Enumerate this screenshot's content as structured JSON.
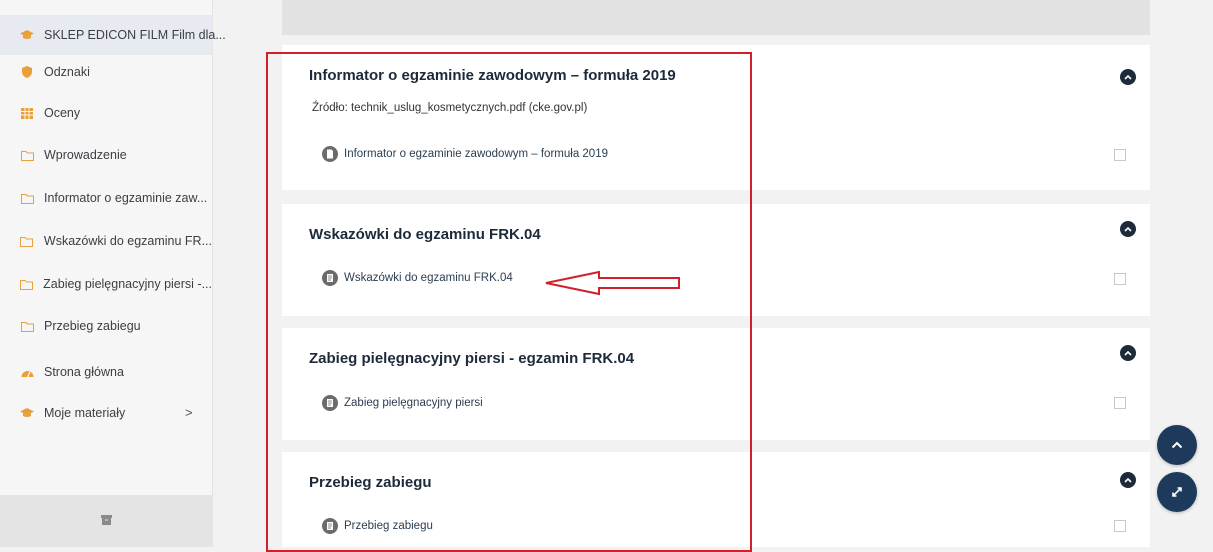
{
  "sidebar": {
    "items": [
      {
        "label": "SKLEP EDICON FILM Film dla...",
        "icon": "graduation-cap-icon",
        "active": true
      },
      {
        "label": "Odznaki",
        "icon": "shield-icon"
      },
      {
        "label": "Oceny",
        "icon": "grid-table-icon"
      },
      {
        "label": "Wprowadzenie",
        "icon": "folder-icon"
      },
      {
        "label": "Informator o egzaminie zaw...",
        "icon": "folder-icon"
      },
      {
        "label": "Wskazówki do egzaminu FR...",
        "icon": "folder-icon"
      },
      {
        "label": "Zabieg pielęgnacyjny piersi -...",
        "icon": "folder-icon"
      },
      {
        "label": "Przebieg zabiegu",
        "icon": "folder-icon"
      },
      {
        "label": "Strona główna",
        "icon": "dashboard-icon"
      },
      {
        "label": "Moje materiały",
        "icon": "graduation-cap-icon",
        "chevron": ">"
      }
    ],
    "footer_icon": "archive-box-icon"
  },
  "sections": [
    {
      "title": "Informator o egzaminie zawodowym – formuła 2019",
      "source": "Źródło: technik_uslug_kosmetycznych.pdf (cke.gov.pl)",
      "activity": "Informator o egzaminie zawodowym – formuła 2019",
      "activity_icon": "document-circle-icon"
    },
    {
      "title": "Wskazówki do egzaminu FRK.04",
      "activity": "Wskazówki do egzaminu FRK.04",
      "activity_icon": "page-icon"
    },
    {
      "title": "Zabieg pielęgnacyjny piersi - egzamin FRK.04",
      "activity": "Zabieg pielęgnacyjny piersi",
      "activity_icon": "page-icon"
    },
    {
      "title": "Przebieg zabiegu",
      "activity": "Przebieg zabiegu",
      "activity_icon": "page-icon"
    }
  ],
  "colors": {
    "accent": "#1d3a5c",
    "annotation": "#d0202a",
    "icon_orange": "#e8a03a"
  },
  "fabs": [
    "chevron-up-icon",
    "expand-icon"
  ]
}
